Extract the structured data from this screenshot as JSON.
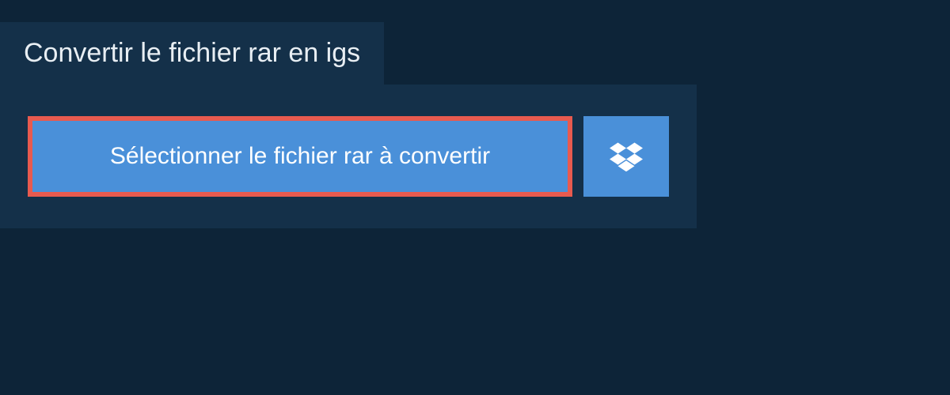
{
  "header": {
    "title": "Convertir le fichier rar en igs"
  },
  "actions": {
    "select_file_label": "Sélectionner le fichier rar à convertir"
  }
}
